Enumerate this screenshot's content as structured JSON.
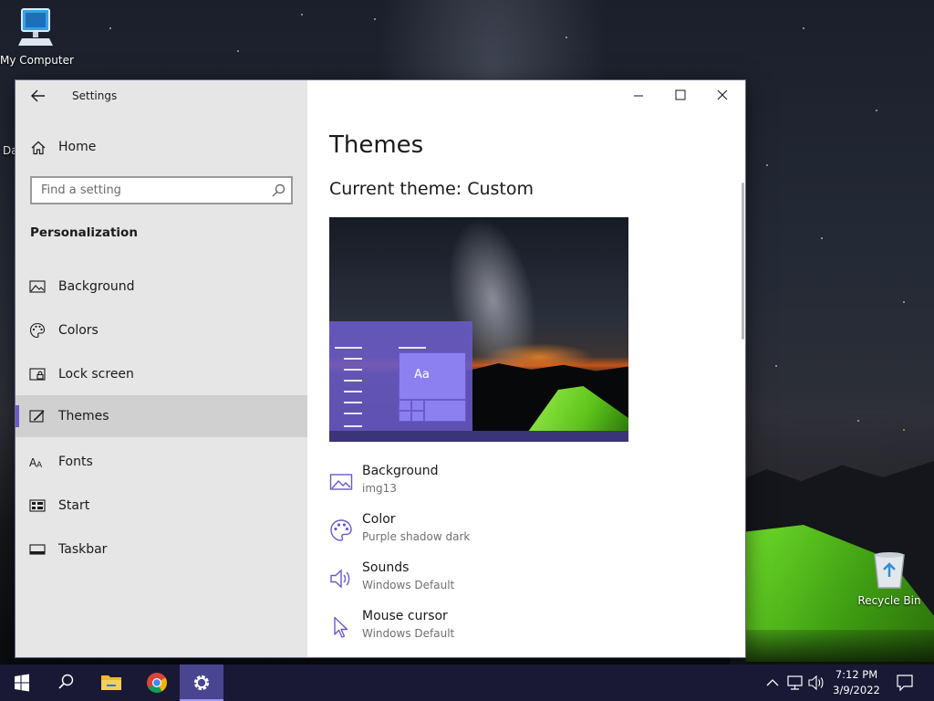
{
  "desktop": {
    "icons": [
      {
        "label": "My Computer",
        "icon": "computer-icon"
      },
      {
        "label": "Recycle Bin",
        "icon": "recycle-bin-icon"
      }
    ],
    "partial_label": "Da"
  },
  "window": {
    "title": "Settings",
    "controls": {
      "minimize": "minimize-icon",
      "maximize": "maximize-icon",
      "close": "close-icon"
    }
  },
  "sidebar": {
    "home_label": "Home",
    "search_placeholder": "Find a setting",
    "section_title": "Personalization",
    "items": [
      {
        "label": "Background",
        "icon": "picture-icon",
        "selected": false
      },
      {
        "label": "Colors",
        "icon": "palette-icon",
        "selected": false
      },
      {
        "label": "Lock screen",
        "icon": "lock-screen-icon",
        "selected": false
      },
      {
        "label": "Themes",
        "icon": "themes-brush-icon",
        "selected": true
      },
      {
        "label": "Fonts",
        "icon": "fonts-icon",
        "selected": false
      },
      {
        "label": "Start",
        "icon": "start-layout-icon",
        "selected": false
      },
      {
        "label": "Taskbar",
        "icon": "taskbar-icon",
        "selected": false
      }
    ]
  },
  "main": {
    "page_title": "Themes",
    "current_theme": "Current theme: Custom",
    "preview": {
      "tile_text": "Aa",
      "accent": "#6a5bc9"
    },
    "theme_settings": [
      {
        "name": "Background",
        "value": "img13",
        "icon": "picture-icon"
      },
      {
        "name": "Color",
        "value": "Purple shadow dark",
        "icon": "palette-icon"
      },
      {
        "name": "Sounds",
        "value": "Windows Default",
        "icon": "speaker-icon"
      },
      {
        "name": "Mouse cursor",
        "value": "Windows Default",
        "icon": "mouse-pointer-icon"
      }
    ]
  },
  "taskbar": {
    "buttons": [
      "windows-start-icon",
      "search-icon",
      "file-explorer-icon",
      "chrome-icon",
      "settings-gear-icon"
    ],
    "active_button": "settings-gear-icon",
    "tray_icons": [
      "chevron-up-icon",
      "network-icon",
      "volume-icon"
    ],
    "time": "7:12 PM",
    "date": "3/9/2022",
    "notification_icon": "action-center-icon"
  },
  "colors": {
    "accent": "#6a5bc9",
    "taskbar": "#191935",
    "sidebar_bg": "#e6e6e6"
  }
}
